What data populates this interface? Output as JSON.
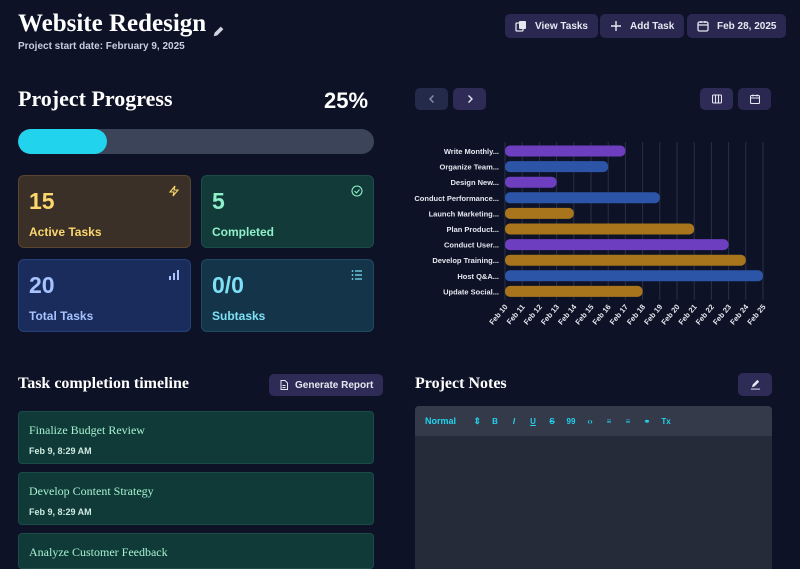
{
  "header": {
    "title": "Website Redesign",
    "subtitle": "Project start date: February 9, 2025",
    "buttons": {
      "view_tasks": "View Tasks",
      "add_task": "Add Task",
      "date": "Feb 28, 2025"
    }
  },
  "progress": {
    "title": "Project Progress",
    "percent_label": "25%",
    "percent": 25
  },
  "stats": {
    "active": {
      "value": "15",
      "label": "Active Tasks"
    },
    "completed": {
      "value": "5",
      "label": "Completed"
    },
    "total": {
      "value": "20",
      "label": "Total Tasks"
    },
    "subtasks": {
      "value": "0/0",
      "label": "Subtasks"
    }
  },
  "colors": {
    "accent": "#22d3ee",
    "purple": "#7c3aed",
    "blue": "#2f5bb5",
    "orange": "#a8741c"
  },
  "chart_data": {
    "type": "bar",
    "orientation": "horizontal-gantt",
    "categories": [
      "Write Monthly...",
      "Organize Team...",
      "Design New...",
      "Conduct Performance...",
      "Launch Marketing...",
      "Plan Product...",
      "Conduct User...",
      "Develop Training...",
      "Host Q&A...",
      "Update Social..."
    ],
    "x_ticks": [
      "Feb 10",
      "Feb 11",
      "Feb 12",
      "Feb 13",
      "Feb 14",
      "Feb 15",
      "Feb 16",
      "Feb 17",
      "Feb 18",
      "Feb 19",
      "Feb 20",
      "Feb 21",
      "Feb 22",
      "Feb 23",
      "Feb 24",
      "Feb 25"
    ],
    "tasks": [
      {
        "start": "Feb 10",
        "end": "Feb 17",
        "color": "purple"
      },
      {
        "start": "Feb 10",
        "end": "Feb 16",
        "color": "blue"
      },
      {
        "start": "Feb 10",
        "end": "Feb 13",
        "color": "purple"
      },
      {
        "start": "Feb 10",
        "end": "Feb 19",
        "color": "blue"
      },
      {
        "start": "Feb 10",
        "end": "Feb 14",
        "color": "orange"
      },
      {
        "start": "Feb 10",
        "end": "Feb 21",
        "color": "orange"
      },
      {
        "start": "Feb 10",
        "end": "Feb 23",
        "color": "purple"
      },
      {
        "start": "Feb 10",
        "end": "Feb 24",
        "color": "orange"
      },
      {
        "start": "Feb 10",
        "end": "Feb 25",
        "color": "blue"
      },
      {
        "start": "Feb 10",
        "end": "Feb 18",
        "color": "orange"
      }
    ]
  },
  "timeline": {
    "title": "Task completion timeline",
    "generate_label": "Generate Report",
    "items": [
      {
        "title": "Finalize Budget Review",
        "date": "Feb 9, 8:29 AM"
      },
      {
        "title": "Develop Content Strategy",
        "date": "Feb 9, 8:29 AM"
      },
      {
        "title": "Analyze Customer Feedback",
        "date": ""
      }
    ]
  },
  "notes": {
    "title": "Project Notes",
    "toolbar": {
      "format": "Normal",
      "bold": "B",
      "italic": "I",
      "underline": "U",
      "strike": "S",
      "quote": "99",
      "code": "‹›",
      "ol": "≡",
      "ul": "≡",
      "link": "⚭",
      "clear": "Tx"
    }
  }
}
